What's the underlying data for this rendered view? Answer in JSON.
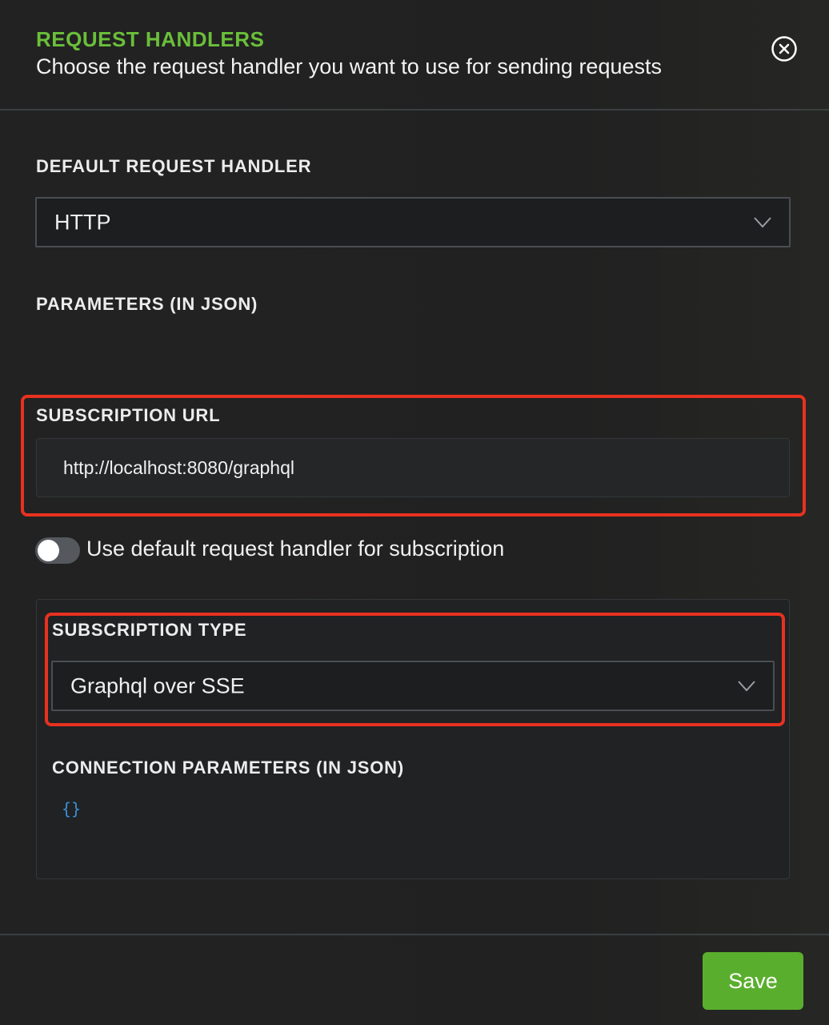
{
  "header": {
    "title": "REQUEST HANDLERS",
    "subtitle": "Choose the request handler you want to use for sending requests",
    "close_icon": "close-circle-icon"
  },
  "default_handler": {
    "label": "DEFAULT REQUEST HANDLER",
    "value": "HTTP"
  },
  "parameters": {
    "label": "PARAMETERS (IN JSON)"
  },
  "subscription_url": {
    "label": "SUBSCRIPTION URL",
    "value": "http://localhost:8080/graphql"
  },
  "use_default_toggle": {
    "label": "Use default request handler for subscription",
    "checked": false
  },
  "subscription_type": {
    "label": "SUBSCRIPTION TYPE",
    "value": "Graphql over SSE"
  },
  "connection_parameters": {
    "label": "CONNECTION PARAMETERS (IN JSON)",
    "value": "{}"
  },
  "footer": {
    "save_label": "Save"
  },
  "colors": {
    "accent": "#6abf3a",
    "save_button": "#5aae2d",
    "highlight": "#e8311f",
    "json_brace": "#3b8fd6"
  }
}
